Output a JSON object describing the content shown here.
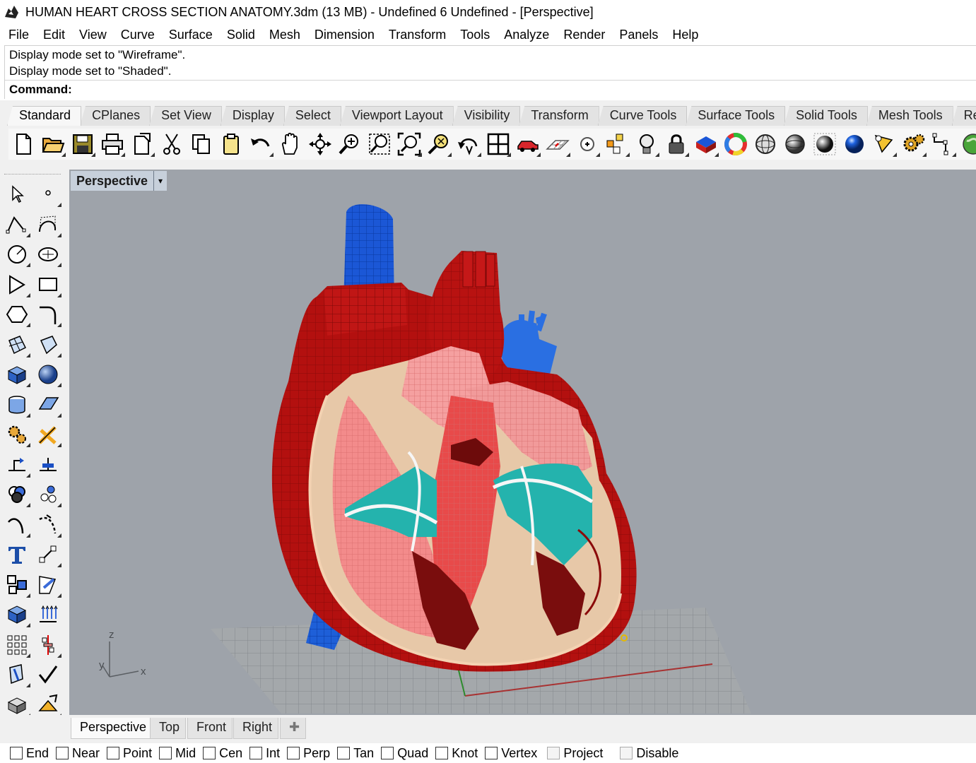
{
  "window": {
    "title": "HUMAN HEART CROSS SECTION ANATOMY.3dm (13 MB) - Undefined 6 Undefined - [Perspective]"
  },
  "menu": [
    "File",
    "Edit",
    "View",
    "Curve",
    "Surface",
    "Solid",
    "Mesh",
    "Dimension",
    "Transform",
    "Tools",
    "Analyze",
    "Render",
    "Panels",
    "Help"
  ],
  "command": {
    "history": [
      "Display mode set to \"Wireframe\".",
      "Display mode set to \"Shaded\"."
    ],
    "prompt_label": "Command:",
    "value": ""
  },
  "toolbar_tabs": [
    "Standard",
    "CPlanes",
    "Set View",
    "Display",
    "Select",
    "Viewport Layout",
    "Visibility",
    "Transform",
    "Curve Tools",
    "Surface Tools",
    "Solid Tools",
    "Mesh Tools",
    "Rer"
  ],
  "toolbar_icons": [
    "new-file-icon",
    "open-folder-icon",
    "save-icon",
    "print-icon",
    "import-icon",
    "cut-icon",
    "copy-icon",
    "paste-icon",
    "undo-icon",
    "pan-hand-icon",
    "rotate-view-icon",
    "zoom-dynamic-icon",
    "zoom-window-icon",
    "zoom-extents-icon",
    "zoom-selected-icon",
    "undo-view-icon",
    "four-viewports-icon",
    "named-view-car-icon",
    "cplane-grid-icon",
    "osnap-point-icon",
    "layers-icon",
    "light-bulb-icon",
    "lock-icon",
    "object-properties-icon",
    "color-wheel-icon",
    "wireframe-sphere-icon",
    "shaded-sphere-icon",
    "rendered-sphere-icon",
    "material-sphere-icon",
    "spotlight-icon",
    "options-gear-icon",
    "dimension-icon",
    "globe-icon"
  ],
  "left_tools": [
    "select-arrow-icon",
    "point-icon",
    "polyline-icon",
    "curve-control-points-icon",
    "circle-icon",
    "ellipse-icon",
    "arc-icon",
    "rectangle-icon",
    "polygon-icon",
    "fillet-curve-icon",
    "surface-corner-points-icon",
    "surface-loft-icon",
    "solid-box-icon",
    "solid-sphere-icon",
    "cylinder-icon",
    "plane-surface-icon",
    "explode-icon",
    "split-icon",
    "move-icon",
    "align-icon",
    "boolean-union-icon",
    "group-icon",
    "curve-offset-icon",
    "trim-curve-icon",
    "text-icon",
    "scale-icon",
    "block-icon",
    "edit-points-icon",
    "extrude-solid-icon",
    "contour-icon",
    "array-icon",
    "mirror-icon",
    "project-icon",
    "check-icon",
    "render-mesh-icon",
    "dimension-tool-icon"
  ],
  "viewport": {
    "label": "Perspective",
    "axes": {
      "z": "z",
      "y": "y",
      "x": "x"
    }
  },
  "viewport_tabs": [
    "Perspective",
    "Top",
    "Front",
    "Right"
  ],
  "viewport_add": "✚",
  "osnaps": [
    {
      "label": "End",
      "checked": false,
      "enabled": true
    },
    {
      "label": "Near",
      "checked": false,
      "enabled": true
    },
    {
      "label": "Point",
      "checked": false,
      "enabled": true
    },
    {
      "label": "Mid",
      "checked": false,
      "enabled": true
    },
    {
      "label": "Cen",
      "checked": false,
      "enabled": true
    },
    {
      "label": "Int",
      "checked": false,
      "enabled": true
    },
    {
      "label": "Perp",
      "checked": false,
      "enabled": true
    },
    {
      "label": "Tan",
      "checked": false,
      "enabled": true
    },
    {
      "label": "Quad",
      "checked": false,
      "enabled": true
    },
    {
      "label": "Knot",
      "checked": false,
      "enabled": true
    },
    {
      "label": "Vertex",
      "checked": false,
      "enabled": true
    },
    {
      "label": "Project",
      "checked": false,
      "enabled": false
    },
    {
      "label": "Disable",
      "checked": false,
      "enabled": false
    }
  ]
}
